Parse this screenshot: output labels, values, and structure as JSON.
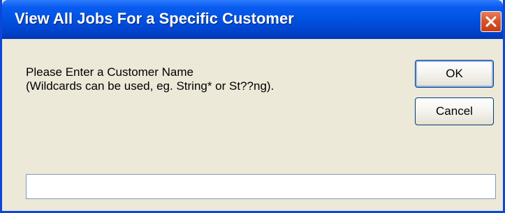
{
  "dialog": {
    "title": "View All Jobs For a Specific Customer",
    "prompt_line1": "Please Enter a Customer Name",
    "prompt_line2": "(Wildcards can be used, eg. String* or St??ng).",
    "ok_label": "OK",
    "cancel_label": "Cancel",
    "input_value": "",
    "close_icon": "close-icon"
  },
  "colors": {
    "titlebar": "#0054e3",
    "window_bg": "#ece9d8",
    "close_button": "#d9532c",
    "text": "#000000",
    "title_text": "#ffffff"
  }
}
